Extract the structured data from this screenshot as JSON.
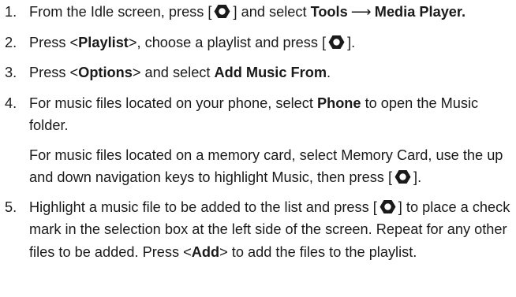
{
  "steps": [
    {
      "number": "1.",
      "t1": "From the Idle screen, press [",
      "t2": "] and select ",
      "menu_tools": "Tools",
      "arrow": "⟶",
      "menu_media_player": "Media Player."
    },
    {
      "number": "2.",
      "t1": "Press <",
      "playlist": "Playlist",
      "t2": ">, choose a playlist and press [",
      "t3": "]."
    },
    {
      "number": "3.",
      "t1": "Press <",
      "options": "Options",
      "t2": "> and select ",
      "add_music_from": "Add Music From",
      "t3": "."
    },
    {
      "number": "4.",
      "t1": "For music files located on your phone, select ",
      "phone": "Phone",
      "t2": " to open the Music folder.",
      "sub_t1": "For music files located on a memory card, select Memory Card, use the up and down navigation keys to highlight Music, then press [",
      "sub_t2": "]."
    },
    {
      "number": "5.",
      "t1": "Highlight a music file to be added to the list and press [",
      "t2": "] to place a check mark in the selection box at the left side of the screen. Repeat for any other files to be added. Press <",
      "add": "Add",
      "t3": "> to add the files to the playlist."
    }
  ],
  "icons": {
    "nav_key": "navigation-key-icon"
  },
  "colors": {
    "text": "#1a1a1a"
  }
}
